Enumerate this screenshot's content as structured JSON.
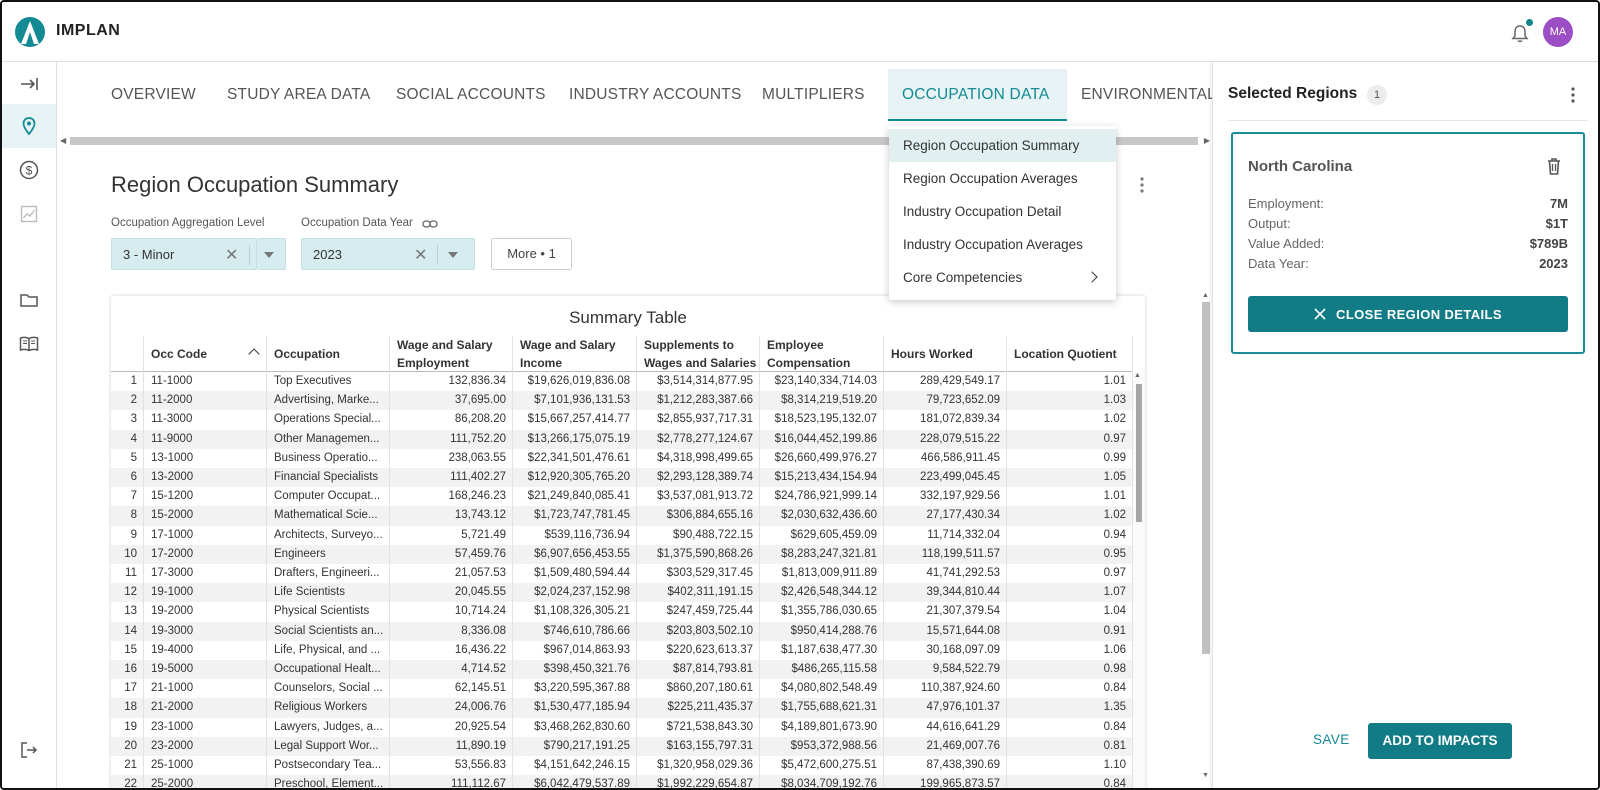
{
  "app": {
    "brand": "IMPLAN",
    "user_initials": "MA",
    "accent": "#138a94",
    "avatar_color": "#9c4fc4"
  },
  "tabs": [
    {
      "label": "OVERVIEW"
    },
    {
      "label": "STUDY AREA DATA"
    },
    {
      "label": "SOCIAL ACCOUNTS"
    },
    {
      "label": "INDUSTRY ACCOUNTS"
    },
    {
      "label": "MULTIPLIERS"
    },
    {
      "label": "OCCUPATION DATA",
      "active": true
    },
    {
      "label": "ENVIRONMENTAL"
    }
  ],
  "menu": {
    "items": [
      {
        "label": "Region Occupation Summary"
      },
      {
        "label": "Region Occupation Averages"
      },
      {
        "label": "Industry Occupation Detail"
      },
      {
        "label": "Industry Occupation Averages"
      },
      {
        "label": "Core Competencies"
      }
    ]
  },
  "main": {
    "title": "Region Occupation Summary",
    "agg_label": "Occupation Aggregation Level",
    "agg_value": "3 - Minor",
    "year_label": "Occupation Data Year",
    "year_value": "2023",
    "more_label": "More • 1"
  },
  "table": {
    "title": "Summary Table",
    "headers": [
      "Occ Code",
      "Occupation",
      "Wage and Salary Employment",
      "Wage and Salary Income",
      "Supplements to Wages and Salaries",
      "Employee Compensation",
      "Hours Worked",
      "Location Quotient"
    ],
    "rows": [
      [
        "1",
        "11-1000",
        "Top Executives",
        "132,836.34",
        "$19,626,019,836.08",
        "$3,514,314,877.95",
        "$23,140,334,714.03",
        "289,429,549.17",
        "1.01"
      ],
      [
        "2",
        "11-2000",
        "Advertising, Marke...",
        "37,695.00",
        "$7,101,936,131.53",
        "$1,212,283,387.66",
        "$8,314,219,519.20",
        "79,723,652.09",
        "1.03"
      ],
      [
        "3",
        "11-3000",
        "Operations Special...",
        "86,208.20",
        "$15,667,257,414.77",
        "$2,855,937,717.31",
        "$18,523,195,132.07",
        "181,072,839.34",
        "1.02"
      ],
      [
        "4",
        "11-9000",
        "Other Managemen...",
        "111,752.20",
        "$13,266,175,075.19",
        "$2,778,277,124.67",
        "$16,044,452,199.86",
        "228,079,515.22",
        "0.97"
      ],
      [
        "5",
        "13-1000",
        "Business Operatio...",
        "238,063.55",
        "$22,341,501,476.61",
        "$4,318,998,499.65",
        "$26,660,499,976.27",
        "466,586,911.45",
        "0.99"
      ],
      [
        "6",
        "13-2000",
        "Financial Specialists",
        "111,402.27",
        "$12,920,305,765.20",
        "$2,293,128,389.74",
        "$15,213,434,154.94",
        "223,499,045.45",
        "1.05"
      ],
      [
        "7",
        "15-1200",
        "Computer Occupat...",
        "168,246.23",
        "$21,249,840,085.41",
        "$3,537,081,913.72",
        "$24,786,921,999.14",
        "332,197,929.56",
        "1.01"
      ],
      [
        "8",
        "15-2000",
        "Mathematical Scie...",
        "13,743.12",
        "$1,723,747,781.45",
        "$306,884,655.16",
        "$2,030,632,436.60",
        "27,177,430.34",
        "1.02"
      ],
      [
        "9",
        "17-1000",
        "Architects, Surveyo...",
        "5,721.49",
        "$539,116,736.94",
        "$90,488,722.15",
        "$629,605,459.09",
        "11,714,332.04",
        "0.94"
      ],
      [
        "10",
        "17-2000",
        "Engineers",
        "57,459.76",
        "$6,907,656,453.55",
        "$1,375,590,868.26",
        "$8,283,247,321.81",
        "118,199,511.57",
        "0.95"
      ],
      [
        "11",
        "17-3000",
        "Drafters, Engineeri...",
        "21,057.53",
        "$1,509,480,594.44",
        "$303,529,317.45",
        "$1,813,009,911.89",
        "41,741,292.53",
        "0.97"
      ],
      [
        "12",
        "19-1000",
        "Life Scientists",
        "20,045.55",
        "$2,024,237,152.98",
        "$402,311,191.15",
        "$2,426,548,344.12",
        "39,344,810.44",
        "1.07"
      ],
      [
        "13",
        "19-2000",
        "Physical Scientists",
        "10,714.24",
        "$1,108,326,305.21",
        "$247,459,725.44",
        "$1,355,786,030.65",
        "21,307,379.54",
        "1.04"
      ],
      [
        "14",
        "19-3000",
        "Social Scientists an...",
        "8,336.08",
        "$746,610,786.66",
        "$203,803,502.10",
        "$950,414,288.76",
        "15,571,644.08",
        "0.91"
      ],
      [
        "15",
        "19-4000",
        "Life, Physical, and ...",
        "16,436.22",
        "$967,014,863.93",
        "$220,623,613.37",
        "$1,187,638,477.30",
        "30,168,097.09",
        "1.06"
      ],
      [
        "16",
        "19-5000",
        "Occupational Healt...",
        "4,714.52",
        "$398,450,321.76",
        "$87,814,793.81",
        "$486,265,115.58",
        "9,584,522.79",
        "0.98"
      ],
      [
        "17",
        "21-1000",
        "Counselors, Social ...",
        "62,145.51",
        "$3,220,595,367.88",
        "$860,207,180.61",
        "$4,080,802,548.49",
        "110,387,924.60",
        "0.84"
      ],
      [
        "18",
        "21-2000",
        "Religious Workers",
        "24,006.76",
        "$1,530,477,185.94",
        "$225,211,435.37",
        "$1,755,688,621.31",
        "47,976,101.37",
        "1.35"
      ],
      [
        "19",
        "23-1000",
        "Lawyers, Judges, a...",
        "20,925.54",
        "$3,468,262,830.60",
        "$721,538,843.30",
        "$4,189,801,673.90",
        "44,616,641.29",
        "0.84"
      ],
      [
        "20",
        "23-2000",
        "Legal Support Wor...",
        "11,890.19",
        "$790,217,191.25",
        "$163,155,797.31",
        "$953,372,988.56",
        "21,469,007.76",
        "0.81"
      ],
      [
        "21",
        "25-1000",
        "Postsecondary Tea...",
        "53,556.83",
        "$4,151,642,246.15",
        "$1,320,958,029.36",
        "$5,472,600,275.51",
        "87,438,390.69",
        "1.10"
      ],
      [
        "22",
        "25-2000",
        "Preschool, Element...",
        "111,112.67",
        "$6,042,479,537.89",
        "$1,992,229,654.87",
        "$8,034,709,192.76",
        "199,965,873.57",
        "0.84"
      ]
    ]
  },
  "panel": {
    "title": "Selected Regions",
    "count": "1",
    "region": {
      "name": "North Carolina",
      "stats": [
        {
          "label": "Employment:",
          "value": "7M"
        },
        {
          "label": "Output:",
          "value": "$1T"
        },
        {
          "label": "Value Added:",
          "value": "$789B"
        },
        {
          "label": "Data Year:",
          "value": "2023"
        }
      ],
      "close_label": "CLOSE REGION DETAILS"
    },
    "save_label": "SAVE",
    "add_label": "ADD TO IMPACTS"
  }
}
